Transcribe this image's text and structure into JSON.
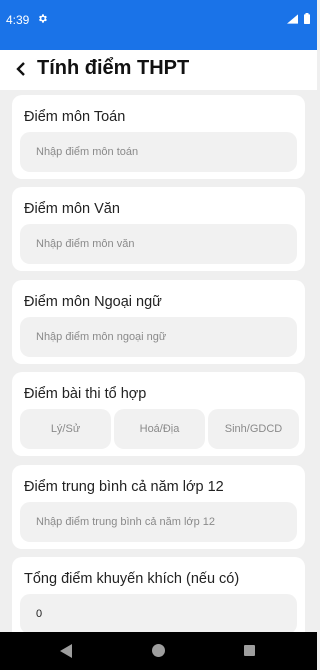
{
  "status_bar": {
    "time": "4:39"
  },
  "app_bar": {
    "title": "Tính điểm THPT"
  },
  "fields": {
    "toan": {
      "label": "Điểm môn Toán",
      "placeholder": "Nhập điểm môn toán"
    },
    "van": {
      "label": "Điểm môn Văn",
      "placeholder": "Nhập điểm môn văn"
    },
    "ngoai_ngu": {
      "label": "Điểm môn Ngoại ngữ",
      "placeholder": "Nhập điểm môn ngoại ngữ"
    },
    "to_hop": {
      "label": "Điểm bài thi tổ hợp",
      "ly_su": "Lý/Sử",
      "hoa_dia": "Hoá/Địa",
      "sinh_gdcd": "Sinh/GDCD"
    },
    "trung_binh": {
      "label": "Điểm trung bình cả năm lớp 12",
      "placeholder": "Nhập điểm trung bình cả năm lớp 12"
    },
    "khuyen_khich": {
      "label": "Tổng điểm khuyến khích (nếu có)",
      "value": "0"
    }
  },
  "colors": {
    "status_bar": "#1a73e8",
    "background": "#efefef",
    "card": "#ffffff",
    "field": "#f1f1f1"
  }
}
